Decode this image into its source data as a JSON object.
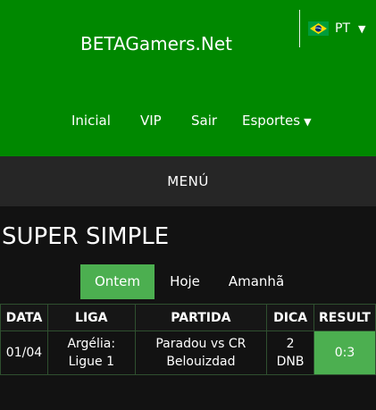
{
  "header": {
    "brand": "BETAGamers.Net",
    "language": {
      "code": "PT",
      "flag": "brazil-flag-icon"
    },
    "nav": [
      {
        "label": "Inicial"
      },
      {
        "label": "VIP"
      },
      {
        "label": "Sair"
      },
      {
        "label": "Esportes"
      }
    ],
    "colors": {
      "primary": "#008800",
      "accent": "#4caf50"
    }
  },
  "menu": {
    "label": "MENÚ"
  },
  "main": {
    "title": "SUPER SIMPLE",
    "tabs": [
      {
        "label": "Ontem",
        "active": true
      },
      {
        "label": "Hoje",
        "active": false
      },
      {
        "label": "Amanhã",
        "active": false
      }
    ],
    "table": {
      "headers": [
        "DATA",
        "LIGA",
        "PARTIDA",
        "DICA",
        "RESULT"
      ],
      "rows": [
        {
          "data": "01/04",
          "liga": [
            "Argélia:",
            "Ligue 1"
          ],
          "partida": [
            "Paradou vs CR",
            "Belouizdad"
          ],
          "dica": [
            "2",
            "DNB"
          ],
          "result": "0:3"
        }
      ]
    }
  }
}
